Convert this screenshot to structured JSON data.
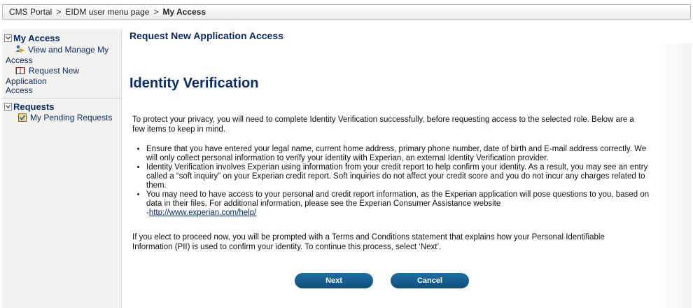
{
  "breadcrumb": {
    "items": [
      "CMS Portal",
      "EIDM user menu page"
    ],
    "separator": ">",
    "current": "My Access"
  },
  "sidebar": {
    "sections": [
      {
        "title": "My Access",
        "items": [
          {
            "icon": "user-key-icon",
            "line1": "View and Manage My",
            "line2": "Access"
          },
          {
            "icon": "book-icon",
            "line1": "Request New Application",
            "line2": "Access"
          }
        ]
      },
      {
        "title": "Requests",
        "items": [
          {
            "icon": "pending-checklist-icon",
            "line1": "My Pending Requests"
          }
        ]
      }
    ]
  },
  "main": {
    "page_title": "Request New Application Access",
    "heading": "Identity Verification",
    "intro": "To protect your privacy, you will need to complete Identity Verification successfully, before requesting access to the selected role. Below are a few items to keep in mind.",
    "bullets": [
      "Ensure that you have entered your legal name, current home address, primary phone number, date of birth and E-mail address correctly. We will only collect personal information to verify your identity with Experian, an external Identity Verification provider.",
      "Identity Verification involves Experian using information from your credit report to help confirm your identity. As a result, you may see an entry called a “soft inquiry” on your Experian credit report. Soft inquiries do not affect your credit score and you do not incur any charges related to them.",
      "You may need to have access to your personal and credit report information, as the Experian application will pose questions to you, based on data in their files. For additional information, please see the Experian Consumer Assistance website"
    ],
    "bullet3_link_prefix": "-",
    "bullet3_link": "http://www.experian.com/help/",
    "outro": "If you elect to proceed now, you will be prompted with a Terms and Conditions statement that explains how your Personal Identifiable Information (PII) is used to confirm your identity. To continue this process, select ‘Next’.",
    "buttons": {
      "next": "Next",
      "cancel": "Cancel"
    }
  },
  "colors": {
    "accent": "#0a2b6a",
    "button": "#145d8f",
    "sidebar_bg": "#f2f2f0"
  }
}
